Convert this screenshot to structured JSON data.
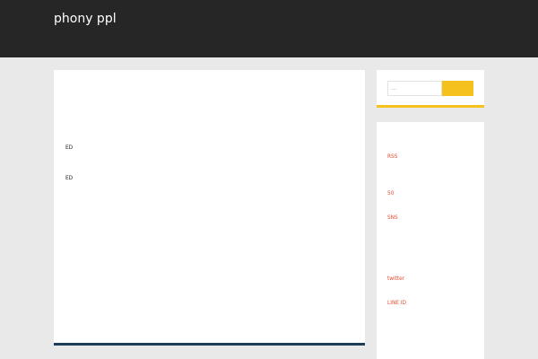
{
  "header": {
    "site_title": "phony ppl  ",
    "nav": [
      "",
      "",
      ""
    ]
  },
  "post": {
    "title": "",
    "paragraphs": [
      "",
      "ED",
      "ED",
      "",
      "",
      "",
      ""
    ]
  },
  "search": {
    "placeholder": " ...",
    "button_label": ""
  },
  "categories": {
    "title": "",
    "items": [
      "RSS",
      "",
      " ",
      "50 ",
      "",
      "SNS ",
      " ",
      " ",
      " ",
      "  ",
      "twitter ",
      "",
      " LINE ID",
      "  ",
      " ",
      ""
    ]
  },
  "colors": {
    "header_bg": "#262626",
    "accent_yellow": "#f5c11c",
    "link_red": "#e34c2f",
    "title_blue": "#2e5e7e",
    "card_border_navy": "#1e3d59"
  }
}
